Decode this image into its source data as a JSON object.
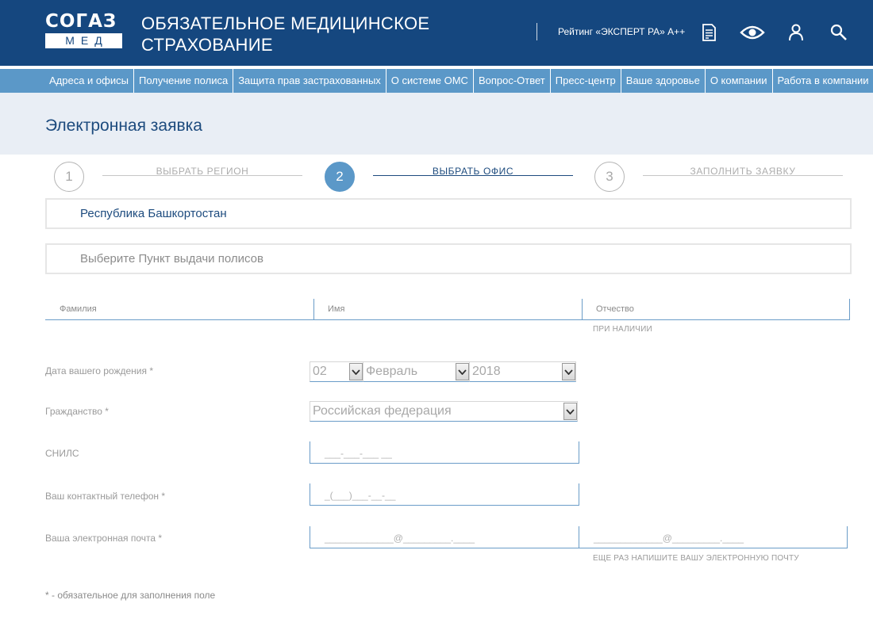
{
  "header": {
    "logo_top": "СОГАЗ",
    "logo_bottom": "МЕД",
    "title_line1": "ОБЯЗАТЕЛЬНОЕ МЕДИЦИНСКОЕ",
    "title_line2": "СТРАХОВАНИЕ",
    "rating": "Рейтинг «ЭКСПЕРТ РА» А++",
    "icons": [
      "document-icon",
      "eye-icon",
      "user-icon",
      "search-icon"
    ],
    "bg_color": "#15477f"
  },
  "nav": {
    "items": [
      "Адреса и офисы",
      "Получение полиса",
      "Защита прав застрахованных",
      "О системе ОМС",
      "Вопрос-Ответ",
      "Пресс-центр",
      "Ваше здоровье",
      "О компании",
      "Работа в компании"
    ],
    "bg_color": "#5b98c8"
  },
  "page": {
    "title": "Электронная заявка"
  },
  "steps": [
    {
      "number": "1",
      "label": "ВЫБРАТЬ РЕГИОН",
      "active": false
    },
    {
      "number": "2",
      "label": "ВЫБРАТЬ ОФИС",
      "active": true
    },
    {
      "number": "3",
      "label": "ЗАПОЛНИТЬ ЗАЯВКУ",
      "active": false
    }
  ],
  "region": {
    "value": "Республика Башкортостан"
  },
  "office": {
    "placeholder": "Выберите Пункт выдачи полисов"
  },
  "name_fields": {
    "last_name": "Фамилия",
    "first_name": "Имя",
    "middle_name": "Отчество",
    "middle_hint": "ПРИ НАЛИЧИИ"
  },
  "birth": {
    "label": "Дата вашего рождения *",
    "day": "02",
    "month": "Февраль",
    "year": "2018"
  },
  "citizenship": {
    "label": "Гражданство *",
    "value": "Российская федерация"
  },
  "snils": {
    "label": "СНИЛС",
    "placeholder": "___-___-___ __"
  },
  "phone": {
    "label": "Ваш контактный телефон *",
    "placeholder": "_(___)___-__-__"
  },
  "email": {
    "label": "Ваша электронная почта *",
    "placeholder": "_____________@_________.____",
    "confirm_placeholder": "_____________@_________.____",
    "confirm_hint": "ЕЩЕ РАЗ НАПИШИТЕ ВАШУ ЭЛЕКТРОННУЮ ПОЧТУ"
  },
  "footnote": "* - обязательное для заполнения поле"
}
